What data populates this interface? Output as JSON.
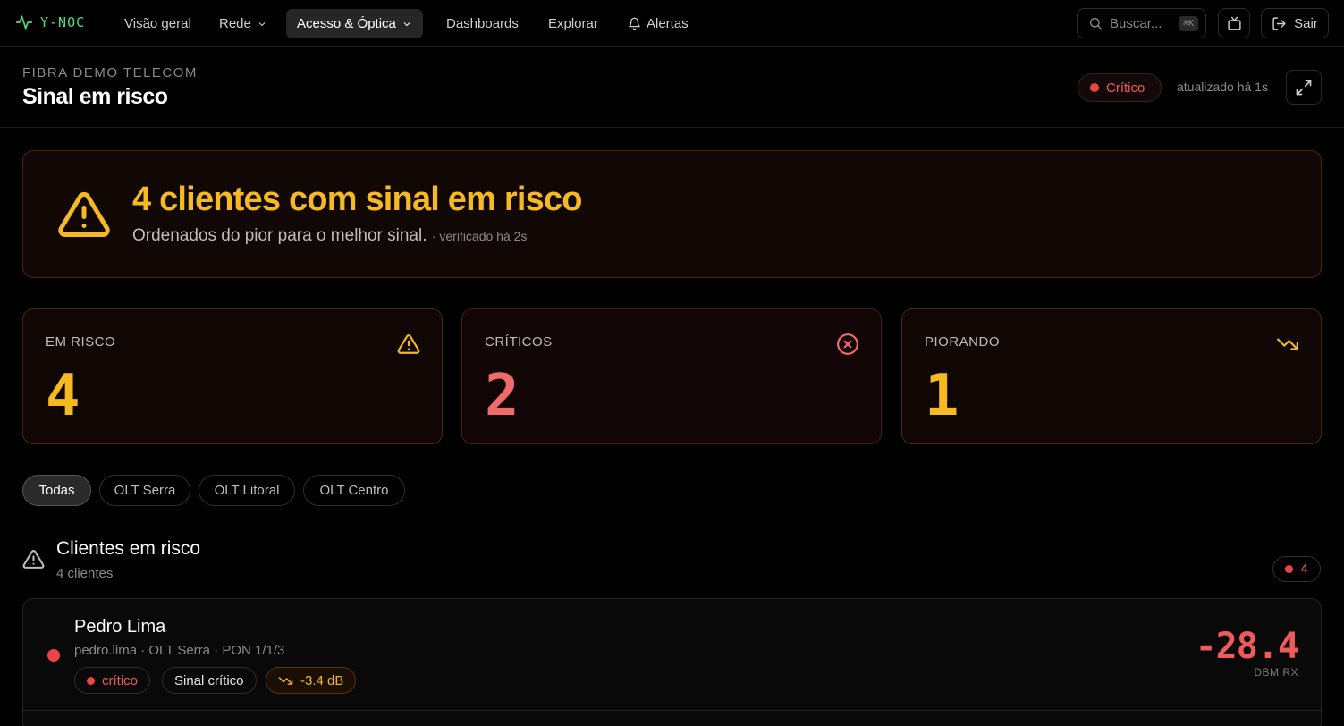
{
  "app": {
    "brand": "Y-NOC"
  },
  "nav": {
    "items": [
      {
        "label": "Visão geral"
      },
      {
        "label": "Rede"
      },
      {
        "label": "Acesso & Óptica"
      },
      {
        "label": "Dashboards"
      },
      {
        "label": "Explorar"
      },
      {
        "label": "Alertas"
      }
    ],
    "search_placeholder": "Buscar...",
    "search_shortcut": "⌘K",
    "logout_label": "Sair"
  },
  "header": {
    "org": "FIBRA DEMO TELECOM",
    "title": "Sinal em risco",
    "status": "Crítico",
    "updated": "atualizado há 1s"
  },
  "banner": {
    "title": "4 clientes com sinal em risco",
    "subtitle": "Ordenados do pior para o melhor sinal.",
    "checked": "· verificado há 2s"
  },
  "stats": [
    {
      "label": "EM RISCO",
      "value": "4",
      "icon": "warning-icon",
      "color": "#f5b921"
    },
    {
      "label": "CRÍTICOS",
      "value": "2",
      "icon": "x-circle-icon",
      "color": "#ef6b6b"
    },
    {
      "label": "PIORANDO",
      "value": "1",
      "icon": "trending-down-icon",
      "color": "#f5b921"
    }
  ],
  "filters": [
    {
      "label": "Todas",
      "active": true
    },
    {
      "label": "OLT Serra"
    },
    {
      "label": "OLT Litoral"
    },
    {
      "label": "OLT Centro"
    }
  ],
  "section": {
    "title": "Clientes em risco",
    "subtitle": "4 clientes",
    "count": "4"
  },
  "clients": [
    {
      "name": "Pedro Lima",
      "meta": "pedro.lima · OLT Serra · PON 1/1/3",
      "severity": "crítico",
      "status": "Sinal crítico",
      "trend": "-3.4 dB",
      "signal": "-28.4",
      "unit": "DBM RX"
    }
  ],
  "colors": {
    "accent": "#4ade80",
    "warning": "#f5b921",
    "critical": "#ef4444"
  }
}
